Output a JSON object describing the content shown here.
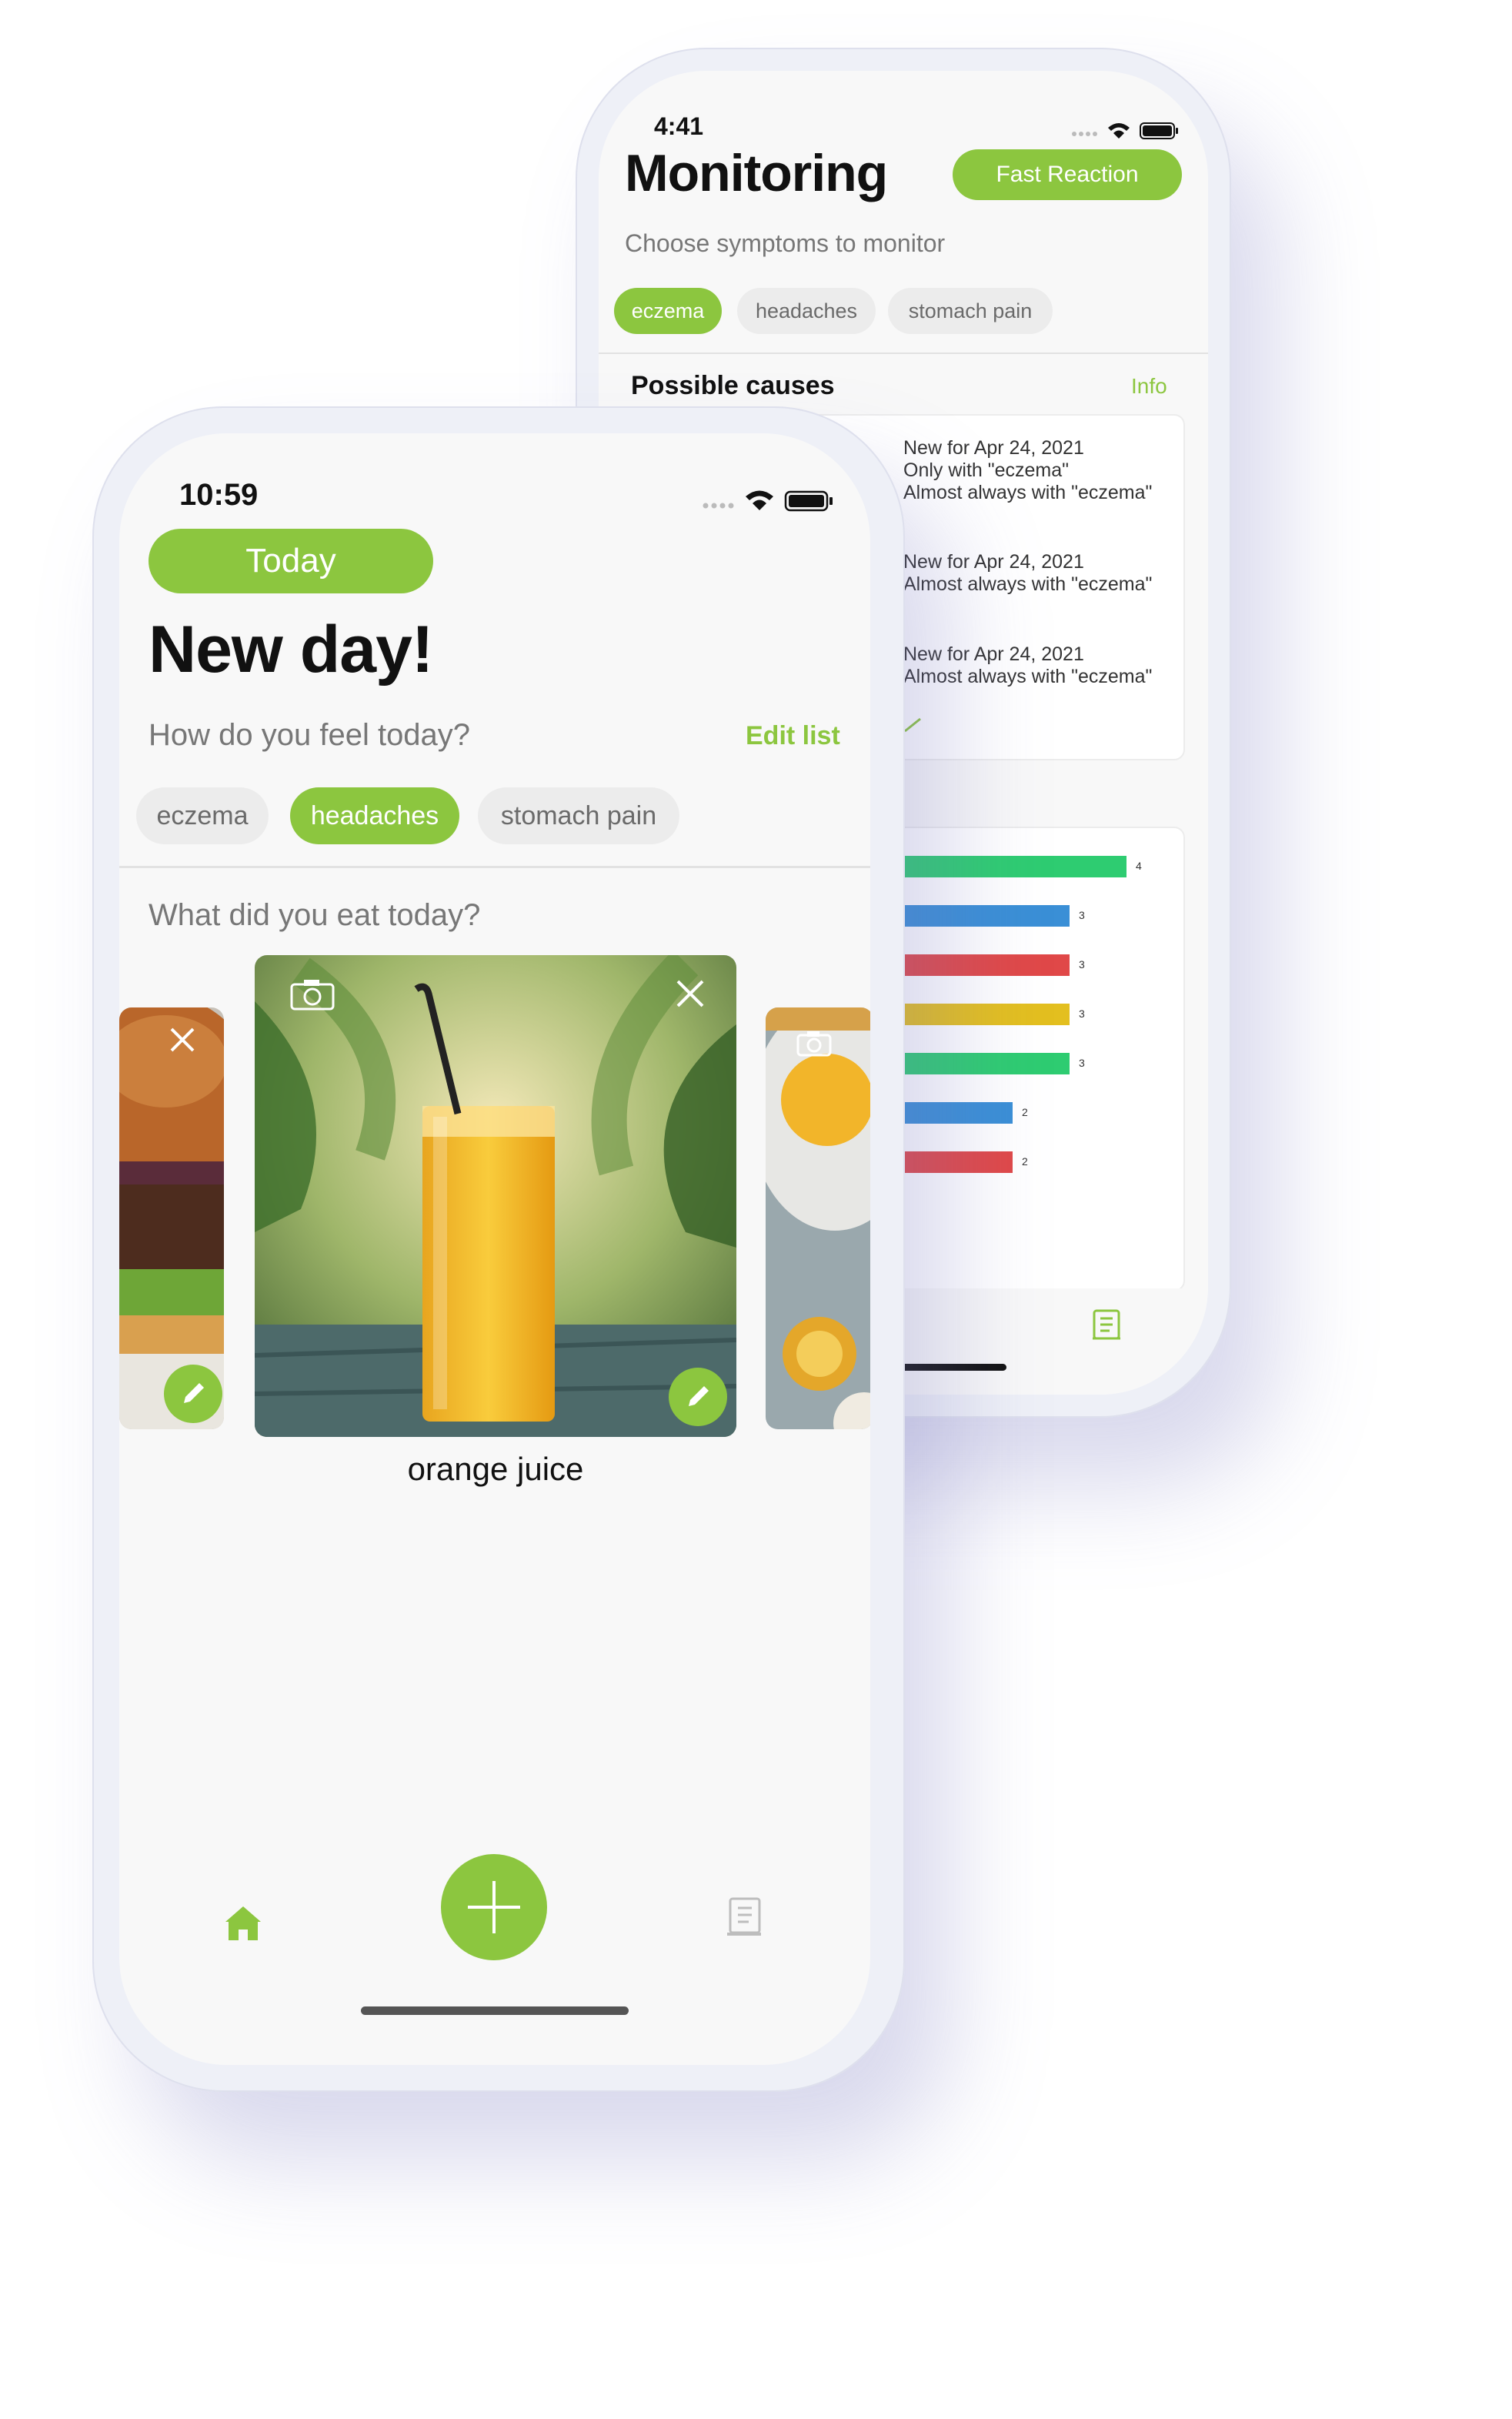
{
  "colors": {
    "accent": "#8cc63f",
    "chip_grey": "#ececec",
    "screen_bg": "#f8f8f8"
  },
  "back_phone": {
    "status_time": "4:41",
    "title": "Monitoring",
    "fast_reaction_label": "Fast Reaction",
    "subtitle": "Choose symptoms to monitor",
    "chips": [
      {
        "label": "eczema",
        "selected": true
      },
      {
        "label": "headaches",
        "selected": false
      },
      {
        "label": "stomach pain",
        "selected": false
      }
    ],
    "causes_title": "Possible causes",
    "info_label": "Info",
    "causes": [
      {
        "lines": [
          "New for Apr 24, 2021",
          "Only with \"eczema\"",
          "Almost always with \"eczema\""
        ]
      },
      {
        "lines": [
          "New for Apr 24, 2021",
          "Almost always with \"eczema\""
        ]
      },
      {
        "lines": [
          "New for Apr 24, 2021",
          "Almost always with \"eczema\""
        ]
      }
    ],
    "chart_data": {
      "type": "bar",
      "orientation": "horizontal",
      "values": [
        4,
        3,
        3,
        3,
        3,
        2,
        2
      ],
      "value_labels": [
        "4",
        "3",
        "3",
        "3",
        "3",
        "2",
        "2"
      ],
      "colors": [
        "#2ecc71",
        "#3a8fd6",
        "#e04848",
        "#e3bf1f",
        "#2ecc71",
        "#3a8fd6",
        "#e04848"
      ]
    }
  },
  "front_phone": {
    "status_time": "10:59",
    "today_label": "Today",
    "title": "New day!",
    "feel_question": "How do you feel today?",
    "edit_list_label": "Edit list",
    "chips": [
      {
        "label": "eczema",
        "selected": false
      },
      {
        "label": "headaches",
        "selected": true
      },
      {
        "label": "stomach pain",
        "selected": false
      }
    ],
    "eat_question": "What did you eat today?",
    "food_caption": "orange juice",
    "tabbar": {
      "home_icon": "home-icon",
      "add_icon": "plus-icon",
      "list_icon": "list-icon"
    }
  }
}
